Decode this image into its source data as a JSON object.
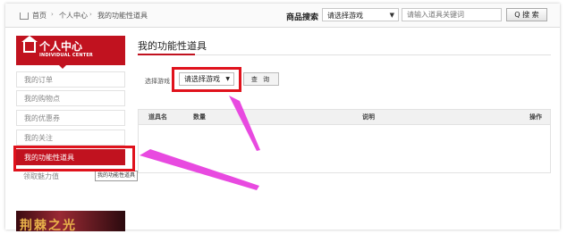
{
  "breadcrumb": {
    "home": "首页",
    "sep": "›",
    "center": "个人中心",
    "current": "我的功能性道具"
  },
  "search": {
    "label": "商品搜索",
    "category_selected": "请选择游戏",
    "keyword_placeholder": "请输入道具关键词",
    "button_label": "Q 搜 索"
  },
  "sidebar": {
    "title": "个人中心",
    "subtitle": "INDIVIDUAL CENTER",
    "items": [
      {
        "label": "我的订单"
      },
      {
        "label": "我的购物点"
      },
      {
        "label": "我的优惠券"
      },
      {
        "label": "我的关注"
      },
      {
        "label": "我的功能性道具"
      },
      {
        "label": "领取魅力值"
      }
    ],
    "tooltip": "我的功能性道具",
    "banner_text": "荆棘之光"
  },
  "main": {
    "title": "我的功能性道具",
    "filter_label": "选择游戏",
    "filter_selected": "请选择游戏",
    "query_button": "查 询",
    "table_headers": [
      "道具名",
      "数量",
      "说明",
      "操作"
    ]
  },
  "colors": {
    "accent": "#c1121f",
    "highlight": "#e0121c",
    "arrow": "#e84ae0"
  }
}
